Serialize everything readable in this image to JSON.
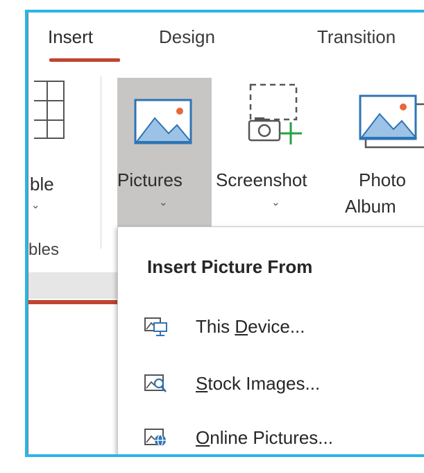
{
  "tabs": {
    "insert": "Insert",
    "design": "Design",
    "transitions": "Transition"
  },
  "ribbon": {
    "table_label": "ble",
    "table_chevron": "⌄",
    "pictures_label": "Pictures",
    "pictures_chevron": "⌄",
    "screenshot_label": "Screenshot",
    "screenshot_chevron": "⌄",
    "photo_album_line1": "Photo",
    "photo_album_line2": "Album",
    "group_label": "bles"
  },
  "dropdown": {
    "title": "Insert Picture From",
    "items": [
      {
        "pre": "This ",
        "accel": "D",
        "post": "evice...",
        "icon": "device-picture-icon"
      },
      {
        "pre": "",
        "accel": "S",
        "post": "tock Images...",
        "icon": "stock-images-icon"
      },
      {
        "pre": "",
        "accel": "O",
        "post": "nline Pictures...",
        "icon": "online-pictures-icon"
      }
    ]
  },
  "colors": {
    "frame": "#29b6e8",
    "accent": "#c0452f",
    "highlight": "#c8c6c4",
    "icon_blue": "#2e74b5",
    "icon_green": "#25a244"
  }
}
